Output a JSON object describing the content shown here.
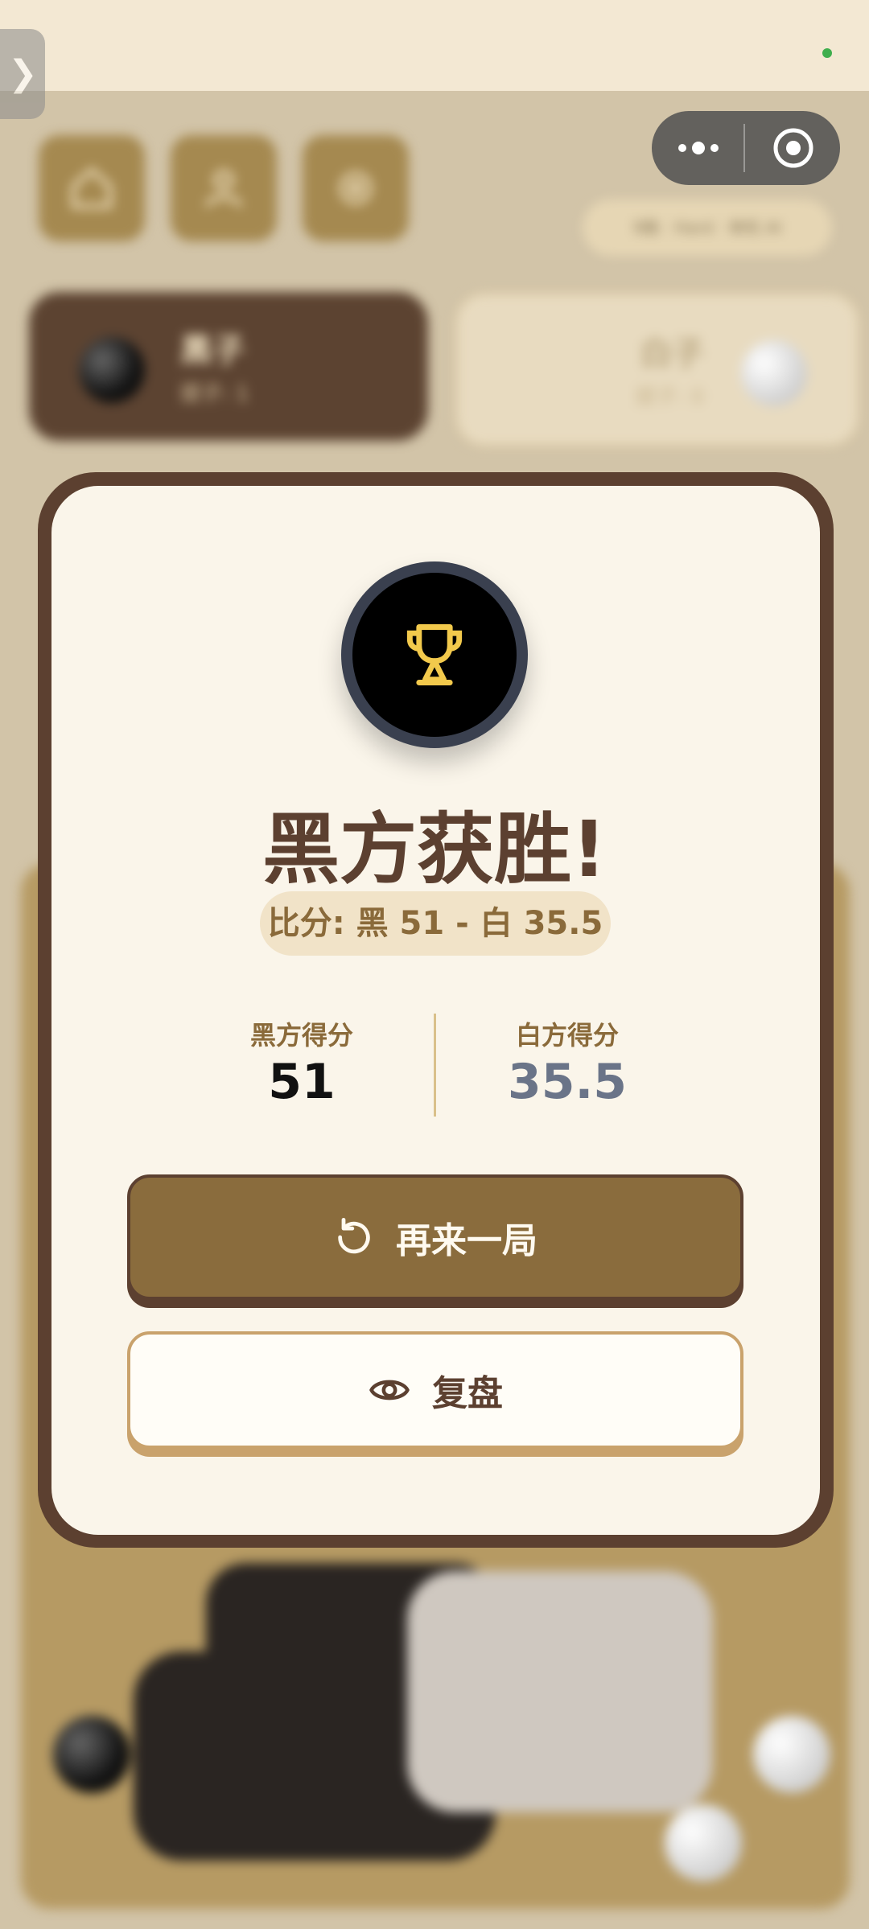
{
  "status_bar": {
    "indicator_color": "#3fae4d"
  },
  "side_tab": {
    "glyph": "❯"
  },
  "capsule": {
    "more_icon": "more-dots-icon",
    "close_icon": "target-close-icon"
  },
  "background": {
    "top_buttons": [
      "home-icon",
      "profile-icon",
      "settings-icon"
    ],
    "mode_label": "9路 · Hard · 单机 AI",
    "black_player": {
      "name": "黑子",
      "sub": "提子: 1"
    },
    "white_player": {
      "name": "白子",
      "sub": "提子: 0"
    }
  },
  "result_dialog": {
    "icon": "trophy-icon",
    "title": "黑方获胜!",
    "score_summary": "比分: 黑 51 - 白 35.5",
    "black_score_label": "黑方得分",
    "black_score_value": "51",
    "white_score_label": "白方得分",
    "white_score_value": "35.5",
    "play_again_label": "再来一局",
    "review_label": "复盘"
  },
  "colors": {
    "brand_brown": "#5c4030",
    "button_gold": "#8a6c3d",
    "trophy_yellow": "#f2c94c",
    "white_score": "#6a7488"
  }
}
